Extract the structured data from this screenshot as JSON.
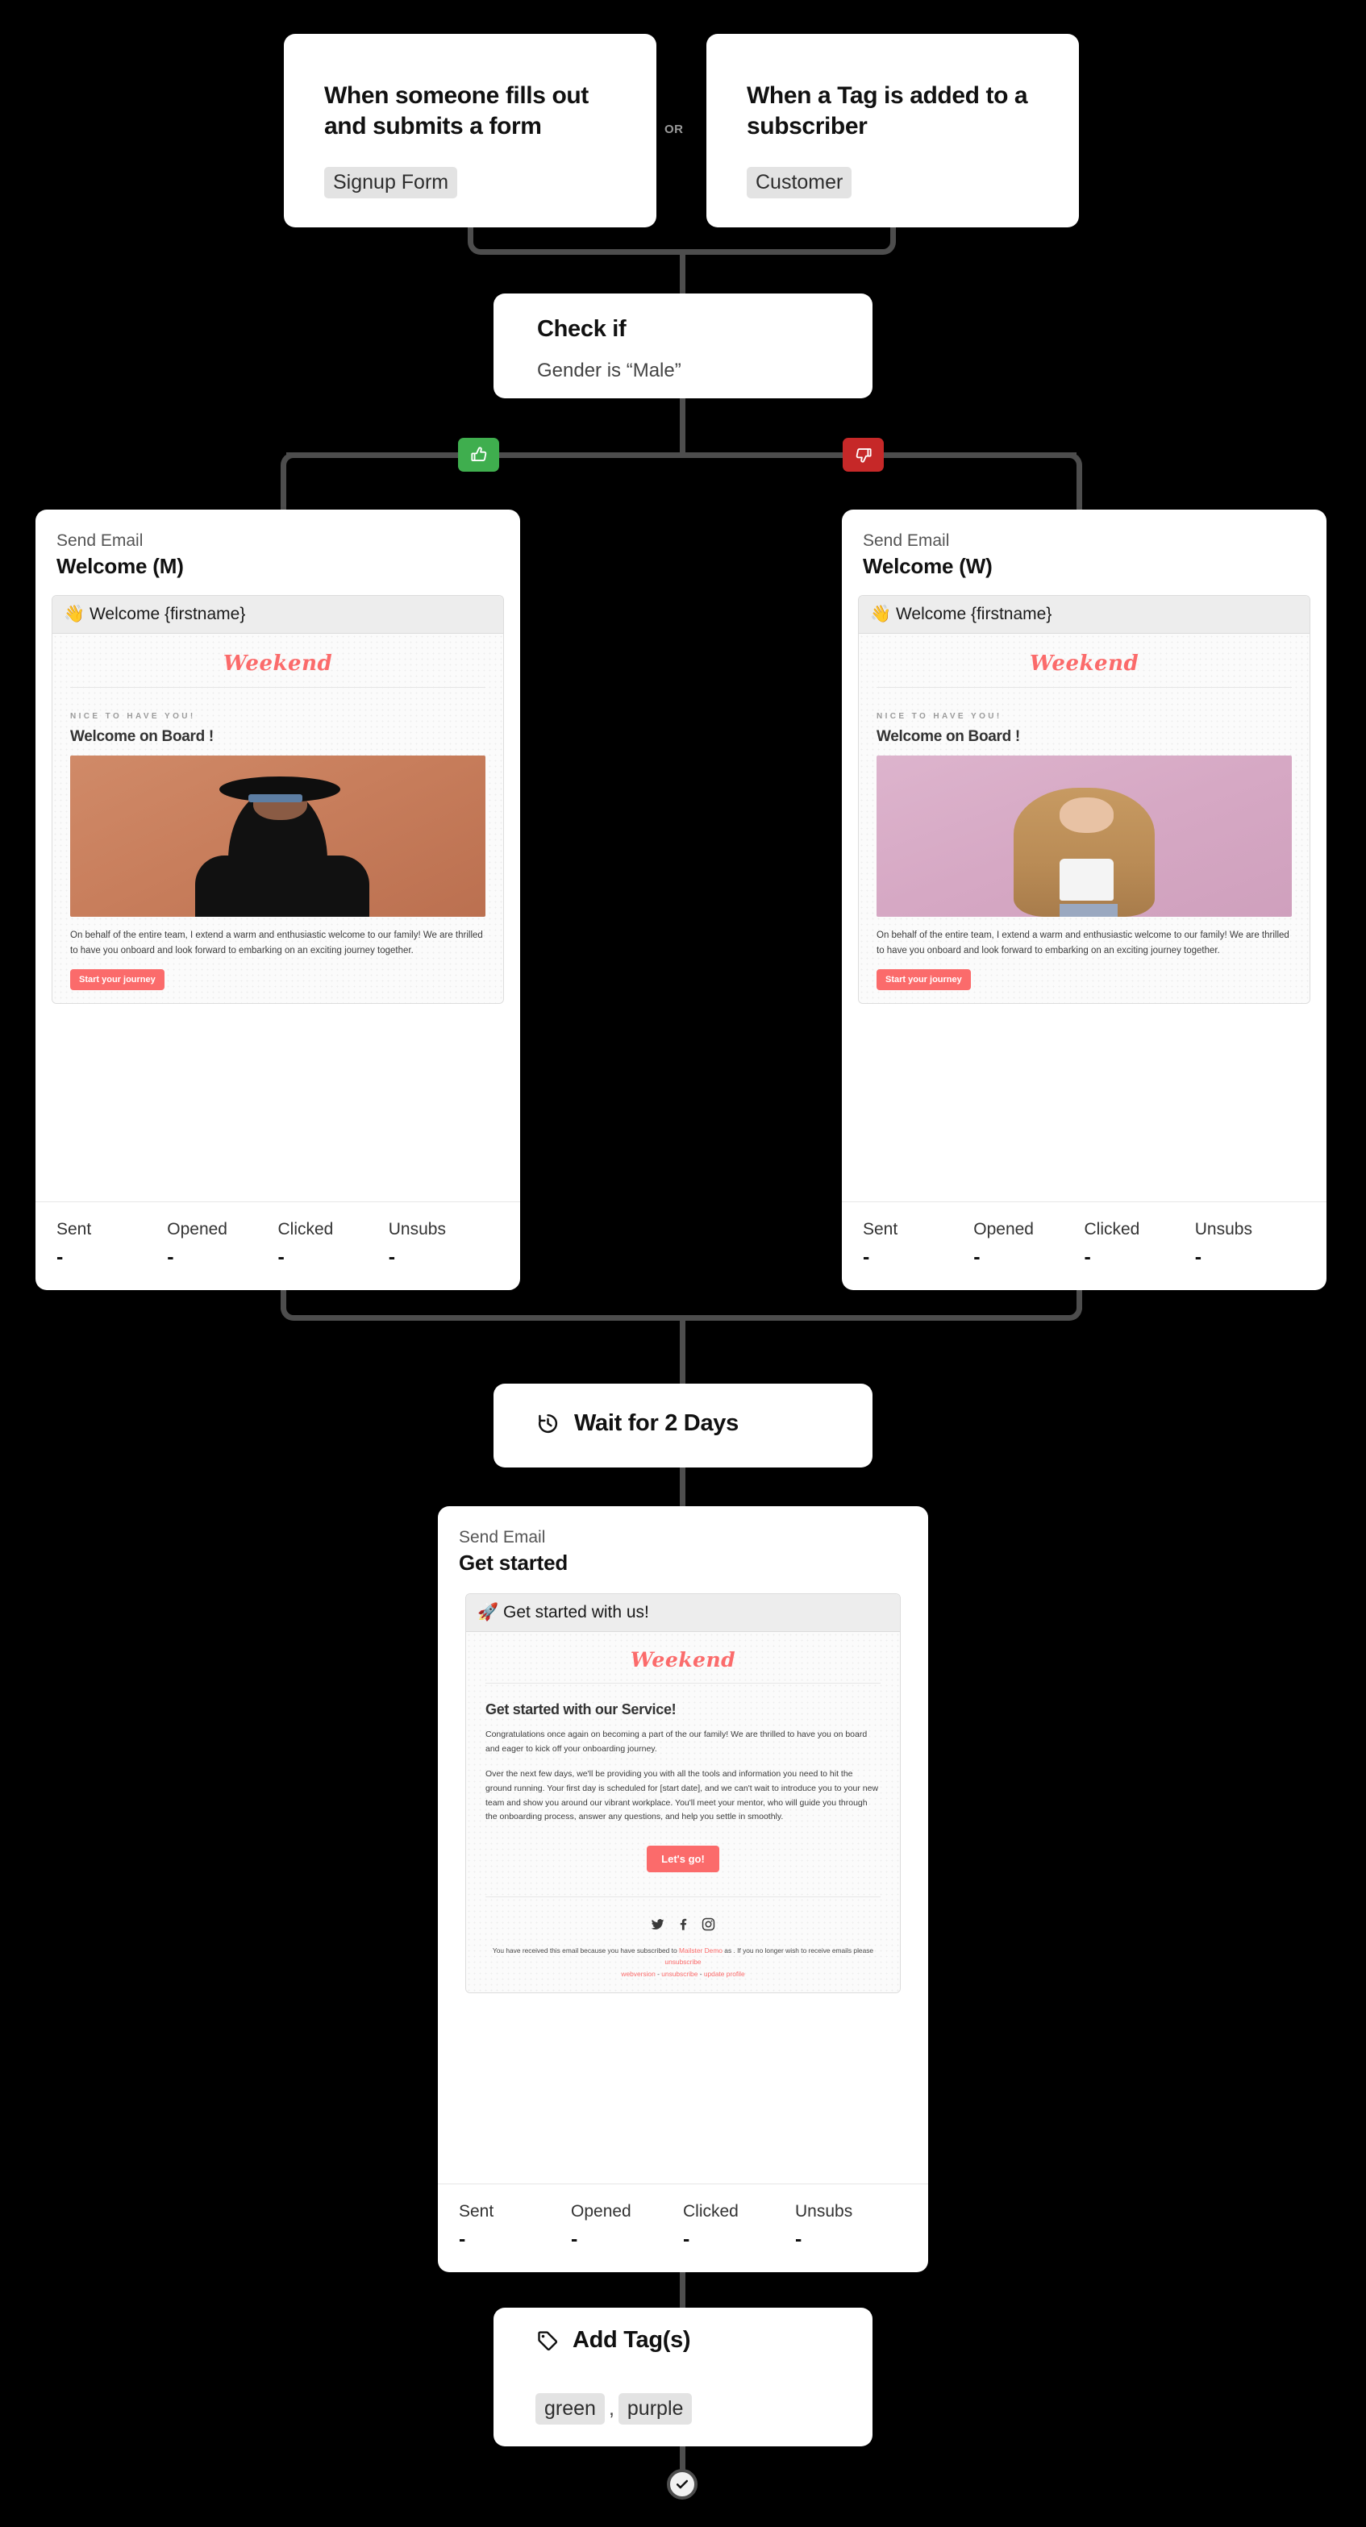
{
  "colors": {
    "connector": "#4d4d4d",
    "yes_badge": "#3fae4e",
    "no_badge": "#c62828",
    "brand_red": "#fb6b6b",
    "pill_bg": "#e3e3e3",
    "card_bg": "#ffffff",
    "canvas_bg": "#000000"
  },
  "triggers": {
    "or_label": "OR",
    "items": [
      {
        "title": "When someone fills out and submits a form",
        "pill": "Signup Form"
      },
      {
        "title": "When a Tag is added to a subscriber",
        "pill": "Customer"
      }
    ]
  },
  "condition": {
    "title": "Check if",
    "subtitle": "Gender is “Male”",
    "yes_icon": "thumbs-up-icon",
    "no_icon": "thumbs-down-icon"
  },
  "emails": [
    {
      "kicker": "Send Email",
      "name": "Welcome (M)",
      "subject": "👋 Welcome {firstname}",
      "preview": {
        "brand": "Weekend",
        "eyebrow": "Nice to have you!",
        "heading": "Welcome on Board !",
        "photo_alt": "man-with-hat-portrait",
        "paragraph": "On behalf of the entire team, I extend a warm and enthusiastic welcome to our family! We are thrilled to have you onboard and look forward to embarking on an exciting journey together.",
        "cta": "Start your journey"
      },
      "stats": [
        {
          "label": "Sent",
          "value": "-"
        },
        {
          "label": "Opened",
          "value": "-"
        },
        {
          "label": "Clicked",
          "value": "-"
        },
        {
          "label": "Unsubs",
          "value": "-"
        }
      ]
    },
    {
      "kicker": "Send Email",
      "name": "Welcome (W)",
      "subject": "👋 Welcome {firstname}",
      "preview": {
        "brand": "Weekend",
        "eyebrow": "Nice to have you!",
        "heading": "Welcome on Board !",
        "photo_alt": "woman-with-long-hair-portrait",
        "paragraph": "On behalf of the entire team, I extend a warm and enthusiastic welcome to our family! We are thrilled to have you onboard and look forward to embarking on an exciting journey together.",
        "cta": "Start your journey"
      },
      "stats": [
        {
          "label": "Sent",
          "value": "-"
        },
        {
          "label": "Opened",
          "value": "-"
        },
        {
          "label": "Clicked",
          "value": "-"
        },
        {
          "label": "Unsubs",
          "value": "-"
        }
      ]
    }
  ],
  "wait": {
    "label": "Wait for 2 Days",
    "icon": "clock-history-icon"
  },
  "get_started": {
    "kicker": "Send Email",
    "name": "Get started",
    "subject": "🚀 Get started with us!",
    "preview": {
      "brand": "Weekend",
      "heading": "Get started with our Service!",
      "paragraph1": "Congratulations once again on becoming a part of the our family! We are thrilled to have you on board and eager to kick off your onboarding journey.",
      "paragraph2": "Over the next few days, we'll be providing you with all the tools and information you need to hit the ground running. Your first day is scheduled for [start date], and we can't wait to introduce you to your new team and show you around our vibrant workplace. You'll meet your mentor, who will guide you through the onboarding process, answer any questions, and help you settle in smoothly.",
      "cta": "Let's go!",
      "social": [
        "twitter-icon",
        "facebook-icon",
        "instagram-icon"
      ],
      "footer_line1_a": "You have received this email because you have subscribed to ",
      "footer_brand": "Mailster Demo",
      "footer_line1_b": " as . If you no longer wish to receive emails please ",
      "footer_unsub": "unsubscribe",
      "footer_links": [
        "webversion",
        "unsubscribe",
        "update profile"
      ]
    },
    "stats": [
      {
        "label": "Sent",
        "value": "-"
      },
      {
        "label": "Opened",
        "value": "-"
      },
      {
        "label": "Clicked",
        "value": "-"
      },
      {
        "label": "Unsubs",
        "value": "-"
      }
    ]
  },
  "add_tags": {
    "title": "Add Tag(s)",
    "icon": "tag-icon",
    "tags": [
      "green",
      "purple"
    ],
    "separator": ","
  },
  "end": {
    "icon": "check-circle-icon"
  }
}
